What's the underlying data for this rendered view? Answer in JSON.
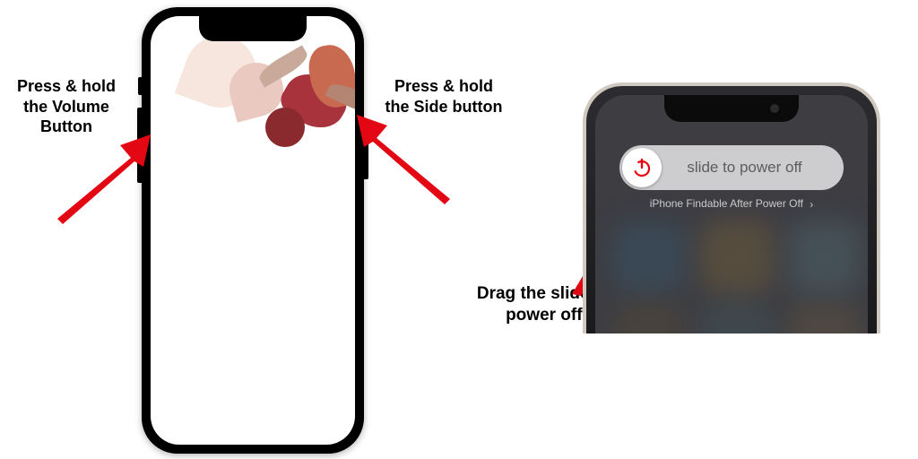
{
  "annotations": {
    "volume": "Press & hold the Volume Button",
    "side": "Press & hold the Side button",
    "drag": "Drag the slider to power offf"
  },
  "phone_right": {
    "slider_label": "slide to power off",
    "findable": "iPhone Findable After Power Off",
    "chevron": "›"
  },
  "colors": {
    "arrow": "#e30613",
    "power_icon": "#e30613"
  }
}
